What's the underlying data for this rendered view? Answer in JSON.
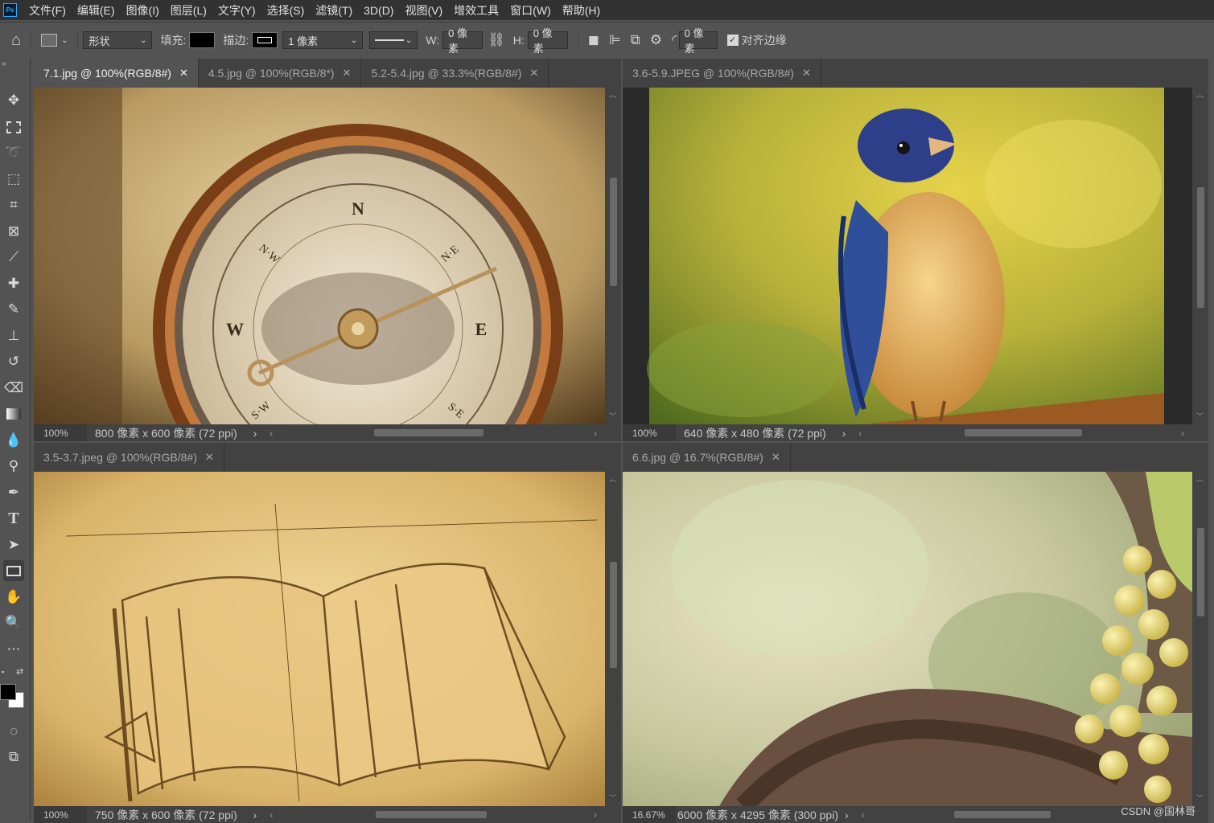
{
  "app_logo": "Ps",
  "menu": [
    "文件(F)",
    "编辑(E)",
    "图像(I)",
    "图层(L)",
    "文字(Y)",
    "选择(S)",
    "滤镜(T)",
    "3D(D)",
    "视图(V)",
    "增效工具",
    "窗口(W)",
    "帮助(H)"
  ],
  "options": {
    "mode": "形状",
    "fill_label": "填充:",
    "stroke_label": "描边:",
    "stroke_width": "1 像素",
    "w_label": "W:",
    "w_value": "0 像素",
    "h_label": "H:",
    "h_value": "0 像素",
    "radius_value": "0 像素",
    "align_edges": "对齐边缘",
    "fill_color": "#000000"
  },
  "tools": [
    "move-tool-icon",
    "marquee-tool-icon",
    "lasso-tool-icon",
    "object-select-icon",
    "crop-icon",
    "frame-icon",
    "eyedropper-icon",
    "healing-brush-icon",
    "brush-icon",
    "stamp-icon",
    "history-brush-icon",
    "eraser-icon",
    "gradient-icon",
    "blur-icon",
    "dodge-icon",
    "pen-icon",
    "type-icon",
    "path-select-icon",
    "rectangle-icon",
    "hand-icon",
    "zoom-icon",
    "more-icon"
  ],
  "panels": {
    "top_left": {
      "tabs": [
        "7.1.jpg @ 100%(RGB/8#)",
        "4.5.jpg @ 100%(RGB/8*)",
        "5.2-5.4.jpg @ 33.3%(RGB/8#)"
      ],
      "zoom": "100%",
      "info": "800 像素 x 600 像素 (72 ppi)"
    },
    "top_right": {
      "tabs": [
        "3.6-5.9.JPEG @ 100%(RGB/8#)"
      ],
      "zoom": "100%",
      "info": "640 像素 x 480 像素 (72 ppi)"
    },
    "bottom_left": {
      "tabs": [
        "3.5-3.7.jpeg @ 100%(RGB/8#)"
      ],
      "zoom": "100%",
      "info": "750 像素 x 600 像素 (72 ppi)"
    },
    "bottom_right": {
      "tabs": [
        "6.6.jpg @ 16.7%(RGB/8#)"
      ],
      "zoom": "16.67%",
      "info": "6000 像素 x 4295 像素 (300 ppi)"
    }
  },
  "compass_labels": {
    "n": "N",
    "e": "E",
    "w": "W",
    "nw": "N·W",
    "ne": "N·E",
    "sw": "S·W",
    "se": "S·E"
  },
  "watermark": "CSDN @国林哥",
  "colors": {
    "bg": "#535353",
    "menubar": "#323232",
    "panel_tab": "#424242",
    "active_tab": "#535353"
  }
}
